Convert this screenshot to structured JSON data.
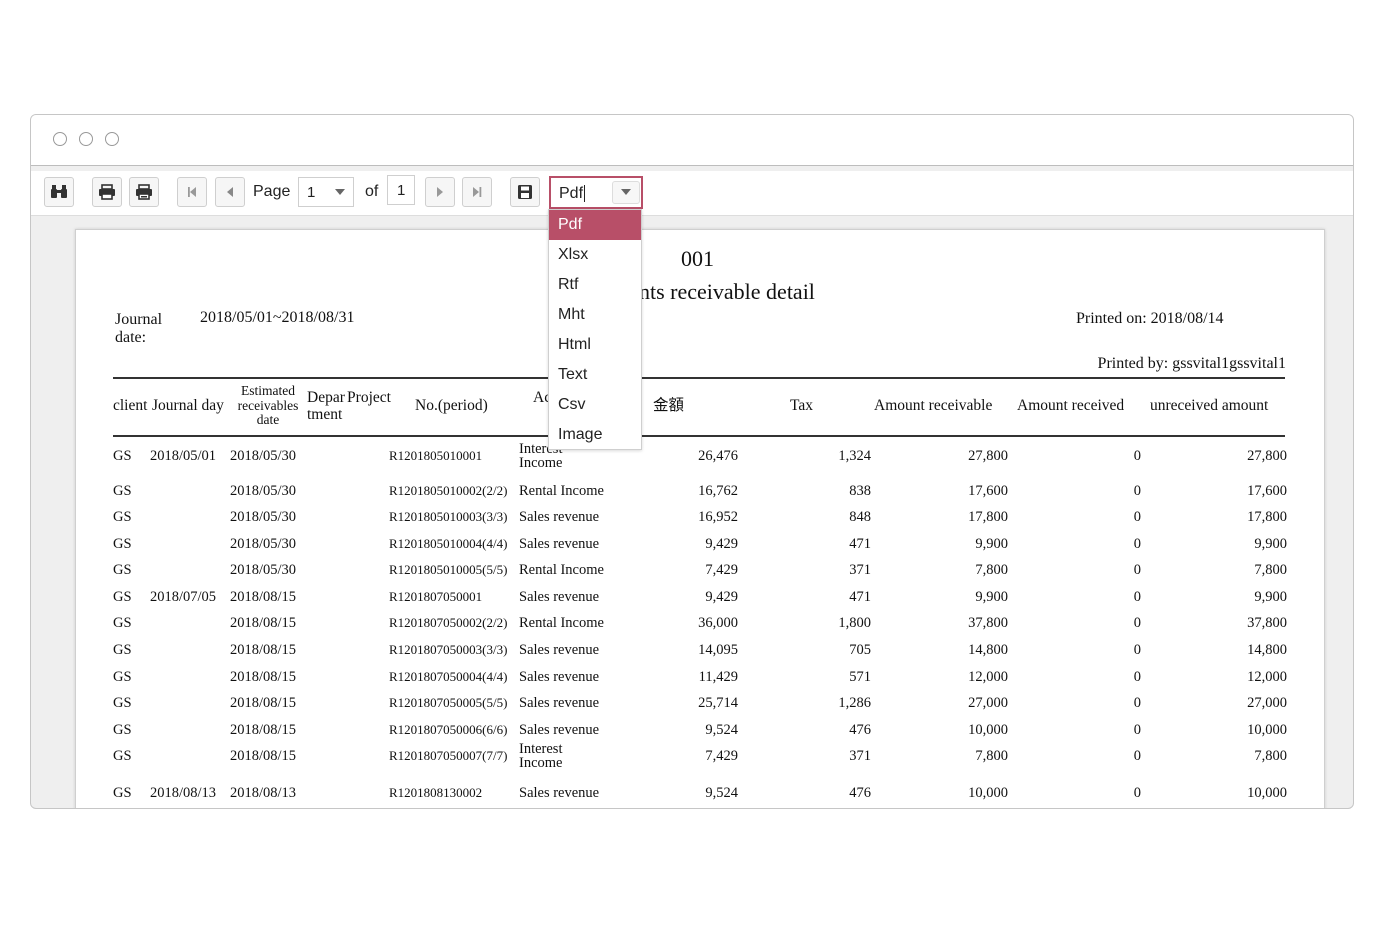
{
  "toolbar": {
    "page_label": "Page",
    "page_value": "1",
    "of_label": "of",
    "total_pages": "1",
    "format_value": "Pdf"
  },
  "format_options": [
    "Pdf",
    "Xlsx",
    "Rtf",
    "Mht",
    "Html",
    "Text",
    "Csv",
    "Image"
  ],
  "accent_color": "#b84f68",
  "report": {
    "code": "001",
    "title_visible": "nts receivable detail",
    "journal_date_label": "Journal date:",
    "journal_date_value": "2018/05/01~2018/08/31",
    "printed_on": "Printed on: 2018/08/14",
    "printed_by": "Printed by: gssvital1gssvital1",
    "columns": {
      "client": "client",
      "journal_day": "Journal day",
      "estimated": "Estimated receivables date",
      "department": "Department",
      "project": "Project",
      "no_period": "No.(period)",
      "account": "Ac",
      "amount_jp": "金額",
      "tax": "Tax",
      "amount_receivable": "Amount receivable",
      "amount_received": "Amount received",
      "unreceived_amount": "unreceived amount"
    },
    "rows": [
      {
        "client": "GS",
        "journal_day": "2018/05/01",
        "est": "2018/05/30",
        "no": "R1201805010001",
        "account": "Interest Income",
        "amount": "26,476",
        "tax": "1,324",
        "receivable": "27,800",
        "received": "0",
        "unreceived": "27,800"
      },
      {
        "client": "GS",
        "journal_day": "",
        "est": "2018/05/30",
        "no": "R1201805010002(2/2)",
        "account": "Rental Income",
        "amount": "16,762",
        "tax": "838",
        "receivable": "17,600",
        "received": "0",
        "unreceived": "17,600"
      },
      {
        "client": "GS",
        "journal_day": "",
        "est": "2018/05/30",
        "no": "R1201805010003(3/3)",
        "account": "Sales revenue",
        "amount": "16,952",
        "tax": "848",
        "receivable": "17,800",
        "received": "0",
        "unreceived": "17,800"
      },
      {
        "client": "GS",
        "journal_day": "",
        "est": "2018/05/30",
        "no": "R1201805010004(4/4)",
        "account": "Sales revenue",
        "amount": "9,429",
        "tax": "471",
        "receivable": "9,900",
        "received": "0",
        "unreceived": "9,900"
      },
      {
        "client": "GS",
        "journal_day": "",
        "est": "2018/05/30",
        "no": "R1201805010005(5/5)",
        "account": "Rental Income",
        "amount": "7,429",
        "tax": "371",
        "receivable": "7,800",
        "received": "0",
        "unreceived": "7,800"
      },
      {
        "client": "GS",
        "journal_day": "2018/07/05",
        "est": "2018/08/15",
        "no": "R1201807050001",
        "account": "Sales revenue",
        "amount": "9,429",
        "tax": "471",
        "receivable": "9,900",
        "received": "0",
        "unreceived": "9,900"
      },
      {
        "client": "GS",
        "journal_day": "",
        "est": "2018/08/15",
        "no": "R1201807050002(2/2)",
        "account": "Rental Income",
        "amount": "36,000",
        "tax": "1,800",
        "receivable": "37,800",
        "received": "0",
        "unreceived": "37,800"
      },
      {
        "client": "GS",
        "journal_day": "",
        "est": "2018/08/15",
        "no": "R1201807050003(3/3)",
        "account": "Sales revenue",
        "amount": "14,095",
        "tax": "705",
        "receivable": "14,800",
        "received": "0",
        "unreceived": "14,800"
      },
      {
        "client": "GS",
        "journal_day": "",
        "est": "2018/08/15",
        "no": "R1201807050004(4/4)",
        "account": "Sales revenue",
        "amount": "11,429",
        "tax": "571",
        "receivable": "12,000",
        "received": "0",
        "unreceived": "12,000"
      },
      {
        "client": "GS",
        "journal_day": "",
        "est": "2018/08/15",
        "no": "R1201807050005(5/5)",
        "account": "Sales revenue",
        "amount": "25,714",
        "tax": "1,286",
        "receivable": "27,000",
        "received": "0",
        "unreceived": "27,000"
      },
      {
        "client": "GS",
        "journal_day": "",
        "est": "2018/08/15",
        "no": "R1201807050006(6/6)",
        "account": "Sales revenue",
        "amount": "9,524",
        "tax": "476",
        "receivable": "10,000",
        "received": "0",
        "unreceived": "10,000"
      },
      {
        "client": "GS",
        "journal_day": "",
        "est": "2018/08/15",
        "no": "R1201807050007(7/7)",
        "account": "Interest Income",
        "amount": "7,429",
        "tax": "371",
        "receivable": "7,800",
        "received": "0",
        "unreceived": "7,800"
      },
      {
        "client": "GS",
        "journal_day": "2018/08/13",
        "est": "2018/08/13",
        "no": "R1201808130002",
        "account": "Sales revenue",
        "amount": "9,524",
        "tax": "476",
        "receivable": "10,000",
        "received": "0",
        "unreceived": "10,000"
      }
    ]
  }
}
